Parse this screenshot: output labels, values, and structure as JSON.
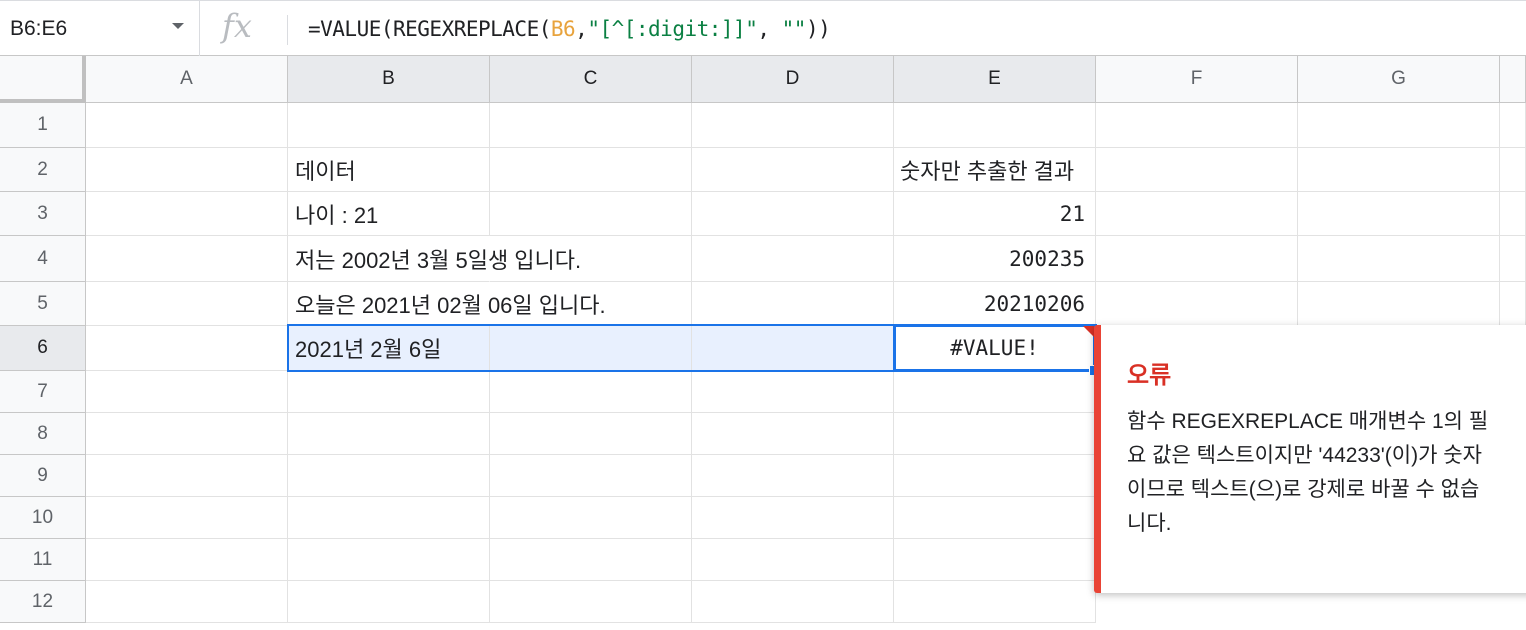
{
  "formula_bar": {
    "name_box": "B6:E6",
    "fx_label": "fx",
    "formula_prefix": "=VALUE(REGEXREPLACE(",
    "formula_ref": "B6",
    "formula_comma": ",",
    "formula_pattern": "\"[^[:digit:]]\"",
    "formula_rest": ", ",
    "formula_empty": "\"\"",
    "formula_suffix": "))"
  },
  "columns": [
    "A",
    "B",
    "C",
    "D",
    "E",
    "F",
    "G"
  ],
  "rows": [
    "1",
    "2",
    "3",
    "4",
    "5",
    "6",
    "7",
    "8",
    "9",
    "10",
    "11",
    "12"
  ],
  "cells": {
    "B2": "데이터",
    "E2": "숫자만 추출한 결과",
    "B3": "나이 : 21",
    "E3": "21",
    "B4": "저는 2002년 3월 5일생 입니다.",
    "E4": "200235",
    "B5": "오늘은 2021년 02월 06일 입니다.",
    "E5": "20210206",
    "B6": "  2021년 2월 6일",
    "E6": "#VALUE!"
  },
  "error_tooltip": {
    "title": "오류",
    "message": "함수 REGEXREPLACE 매개변수 1의 필요 값은 텍스트이지만 '44233'(이)가 숫자이므로 텍스트(으)로 강제로 바꿀 수 없습니다."
  },
  "colors": {
    "selection": "#1a73e8",
    "selection_fill": "#e8f0fe",
    "error": "#d93025",
    "formula_ref": "#e8a33d",
    "formula_string": "#0b8043"
  }
}
